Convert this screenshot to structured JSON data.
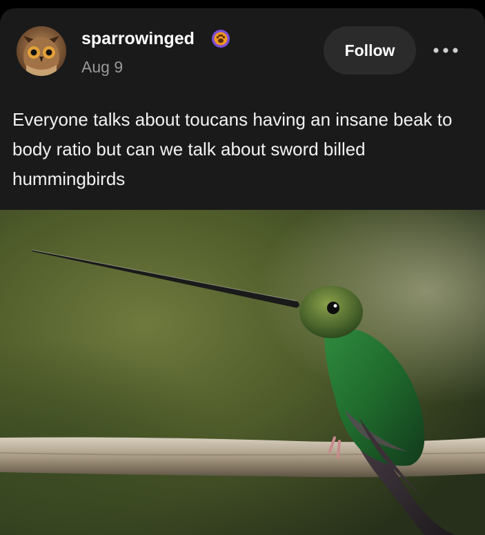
{
  "post": {
    "author": {
      "username": "sparrowinged",
      "avatar_icon": "owl-avatar",
      "badge_icon": "paw-badge-icon",
      "badge_color": "#7b4dd6",
      "badge_inner_color": "#f29a1e"
    },
    "date": "Aug 9",
    "follow_label": "Follow",
    "more_icon": "more-options-icon",
    "body_text": "Everyone talks about toucans having an insane beak to body ratio but can we talk about sword billed hummingbirds",
    "image_subject": "sword-billed-hummingbird-photo"
  },
  "colors": {
    "card_background": "#1a1a1a",
    "button_background": "#2b2b2b",
    "secondary_text": "#9a9a9a"
  }
}
